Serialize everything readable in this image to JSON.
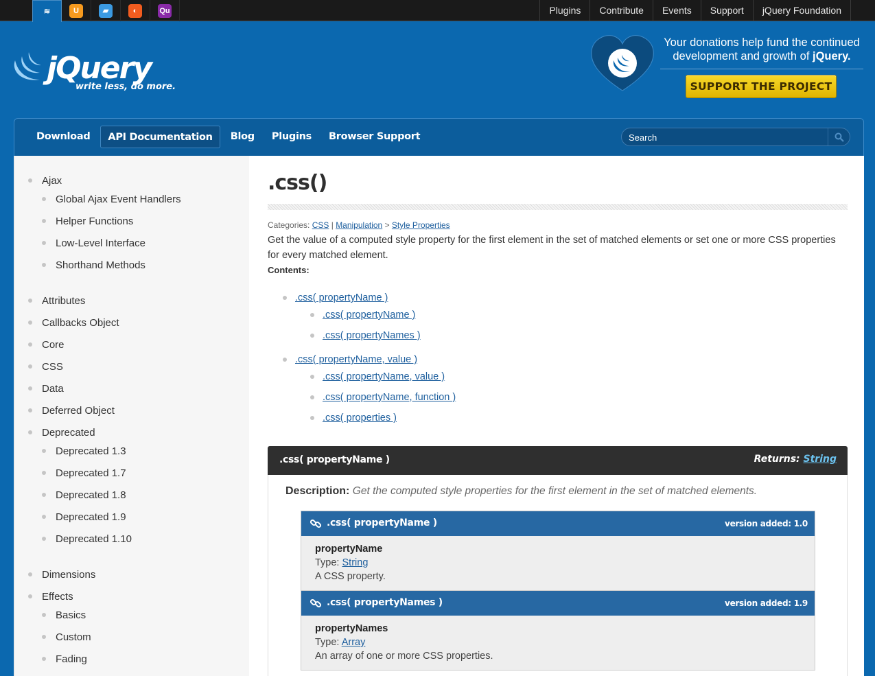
{
  "topbar": {
    "sites": [
      {
        "name": "jquery-site-icon",
        "color": "#0b68af",
        "glyph": "≋"
      },
      {
        "name": "jquery-ui-site-icon",
        "color": "#f79a1e",
        "glyph": "U"
      },
      {
        "name": "jquery-mobile-site-icon",
        "color": "#3b9ae1",
        "glyph": "▰"
      },
      {
        "name": "sizzle-site-icon",
        "color": "#f25c1f",
        "glyph": "◐"
      },
      {
        "name": "qunit-site-icon",
        "color": "#8a2aa8",
        "glyph": "Qu"
      }
    ],
    "links": [
      "Plugins",
      "Contribute",
      "Events",
      "Support",
      "jQuery Foundation"
    ]
  },
  "header": {
    "logo_text": "jQuery",
    "tagline": "write less, do more.",
    "donate_line1": "Your donations help fund the continued",
    "donate_line2_prefix": "development and growth of ",
    "donate_line2_brand": "jQuery.",
    "support_button": "SUPPORT THE PROJECT"
  },
  "nav": {
    "items": [
      "Download",
      "API Documentation",
      "Blog",
      "Plugins",
      "Browser Support"
    ],
    "active_index": 1,
    "search_placeholder": "Search"
  },
  "sidebar": {
    "items": [
      {
        "label": "Ajax",
        "sub": false
      },
      {
        "label": "Global Ajax Event Handlers",
        "sub": true
      },
      {
        "label": "Helper Functions",
        "sub": true
      },
      {
        "label": "Low-Level Interface",
        "sub": true
      },
      {
        "label": "Shorthand Methods",
        "sub": true
      },
      {
        "label": "Attributes",
        "sub": false
      },
      {
        "label": "Callbacks Object",
        "sub": false
      },
      {
        "label": "Core",
        "sub": false
      },
      {
        "label": "CSS",
        "sub": false
      },
      {
        "label": "Data",
        "sub": false
      },
      {
        "label": "Deferred Object",
        "sub": false
      },
      {
        "label": "Deprecated",
        "sub": false
      },
      {
        "label": "Deprecated 1.3",
        "sub": true
      },
      {
        "label": "Deprecated 1.7",
        "sub": true
      },
      {
        "label": "Deprecated 1.8",
        "sub": true
      },
      {
        "label": "Deprecated 1.9",
        "sub": true
      },
      {
        "label": "Deprecated 1.10",
        "sub": true
      },
      {
        "label": "Dimensions",
        "sub": false
      },
      {
        "label": "Effects",
        "sub": false
      },
      {
        "label": "Basics",
        "sub": true
      },
      {
        "label": "Custom",
        "sub": true
      },
      {
        "label": "Fading",
        "sub": true
      }
    ]
  },
  "main": {
    "title": ".css()",
    "categories_label": "Categories: ",
    "categories": [
      "CSS",
      "Manipulation",
      "Style Properties"
    ],
    "cat_sep1": " | ",
    "cat_sep2": " > ",
    "lead": "Get the value of a computed style property for the first element in the set of matched elements or set one or more CSS properties for every matched element.",
    "contents_label": "Contents:",
    "toc": [
      {
        "label": ".css( propertyName )",
        "level": 0
      },
      {
        "label": ".css( propertyName )",
        "level": 1
      },
      {
        "label": ".css( propertyNames )",
        "level": 1
      },
      {
        "label": ".css( propertyName, value )",
        "level": 0
      },
      {
        "label": ".css( propertyName, value )",
        "level": 1
      },
      {
        "label": ".css( propertyName, function )",
        "level": 1
      },
      {
        "label": ".css( properties )",
        "level": 1
      }
    ],
    "entry": {
      "signature": ".css( propertyName )",
      "returns_label": "Returns: ",
      "returns_type": "String",
      "description_label": "Description:",
      "description": "Get the computed style properties for the first element in the set of matched elements.",
      "versions": [
        {
          "signature": ".css( propertyName )",
          "version": "version added: 1.0",
          "param_name": "propertyName",
          "type_label": "Type: ",
          "type": "String",
          "param_desc": "A CSS property."
        },
        {
          "signature": ".css( propertyNames )",
          "version": "version added: 1.9",
          "param_name": "propertyNames",
          "type_label": "Type: ",
          "type": "Array",
          "param_desc": "An array of one or more CSS properties."
        }
      ]
    }
  }
}
